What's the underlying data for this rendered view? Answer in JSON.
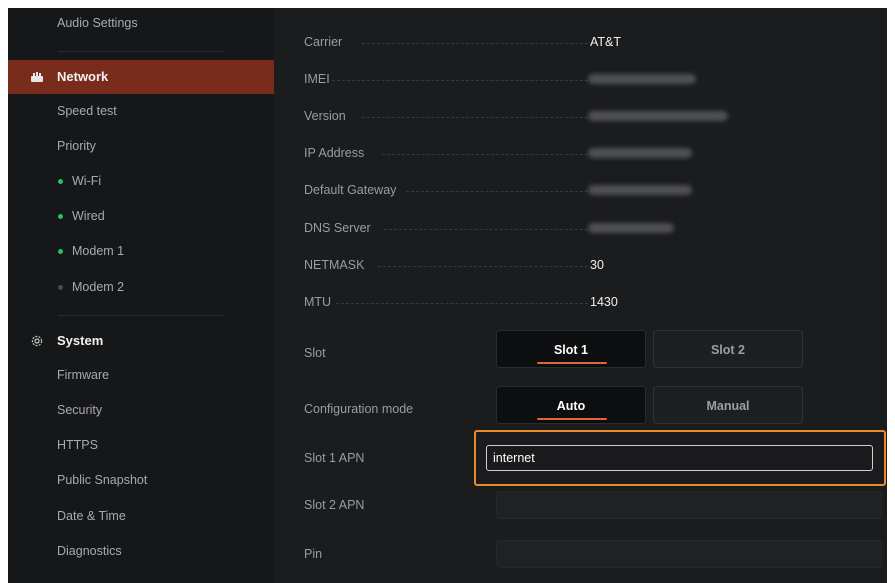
{
  "sidebar": {
    "audio_settings": "Audio Settings",
    "network": {
      "label": "Network"
    },
    "speed_test": "Speed test",
    "priority": "Priority",
    "wifi": {
      "label": "Wi-Fi",
      "status_color": "#22c55e"
    },
    "wired": {
      "label": "Wired",
      "status_color": "#22c55e"
    },
    "modem1": {
      "label": "Modem 1",
      "status_color": "#22c55e"
    },
    "modem2": {
      "label": "Modem 2",
      "status_color": "#4a4b4e"
    },
    "system": {
      "label": "System"
    },
    "firmware": "Firmware",
    "security": "Security",
    "https": "HTTPS",
    "public_snapshot": "Public Snapshot",
    "date_time": "Date & Time",
    "diagnostics": "Diagnostics"
  },
  "details": {
    "carrier": {
      "label": "Carrier",
      "value": "AT&T"
    },
    "imei": {
      "label": "IMEI"
    },
    "version": {
      "label": "Version"
    },
    "ip_address": {
      "label": "IP Address"
    },
    "default_gateway": {
      "label": "Default Gateway"
    },
    "dns_server": {
      "label": "DNS Server"
    },
    "netmask": {
      "label": "NETMASK",
      "value": "30"
    },
    "mtu": {
      "label": "MTU",
      "value": "1430"
    }
  },
  "slot": {
    "label": "Slot",
    "options": [
      "Slot 1",
      "Slot 2"
    ],
    "selected": "Slot 1"
  },
  "config_mode": {
    "label": "Configuration mode",
    "options": [
      "Auto",
      "Manual"
    ],
    "selected": "Auto"
  },
  "slot1_apn": {
    "label": "Slot 1 APN",
    "value": "internet"
  },
  "slot2_apn": {
    "label": "Slot 2 APN"
  },
  "pin": {
    "label": "Pin"
  },
  "theme": {
    "accent": "#e8643c",
    "focus": "#e88a2a",
    "active_bg": "#7a2c1c",
    "status_online": "#22c55e"
  }
}
